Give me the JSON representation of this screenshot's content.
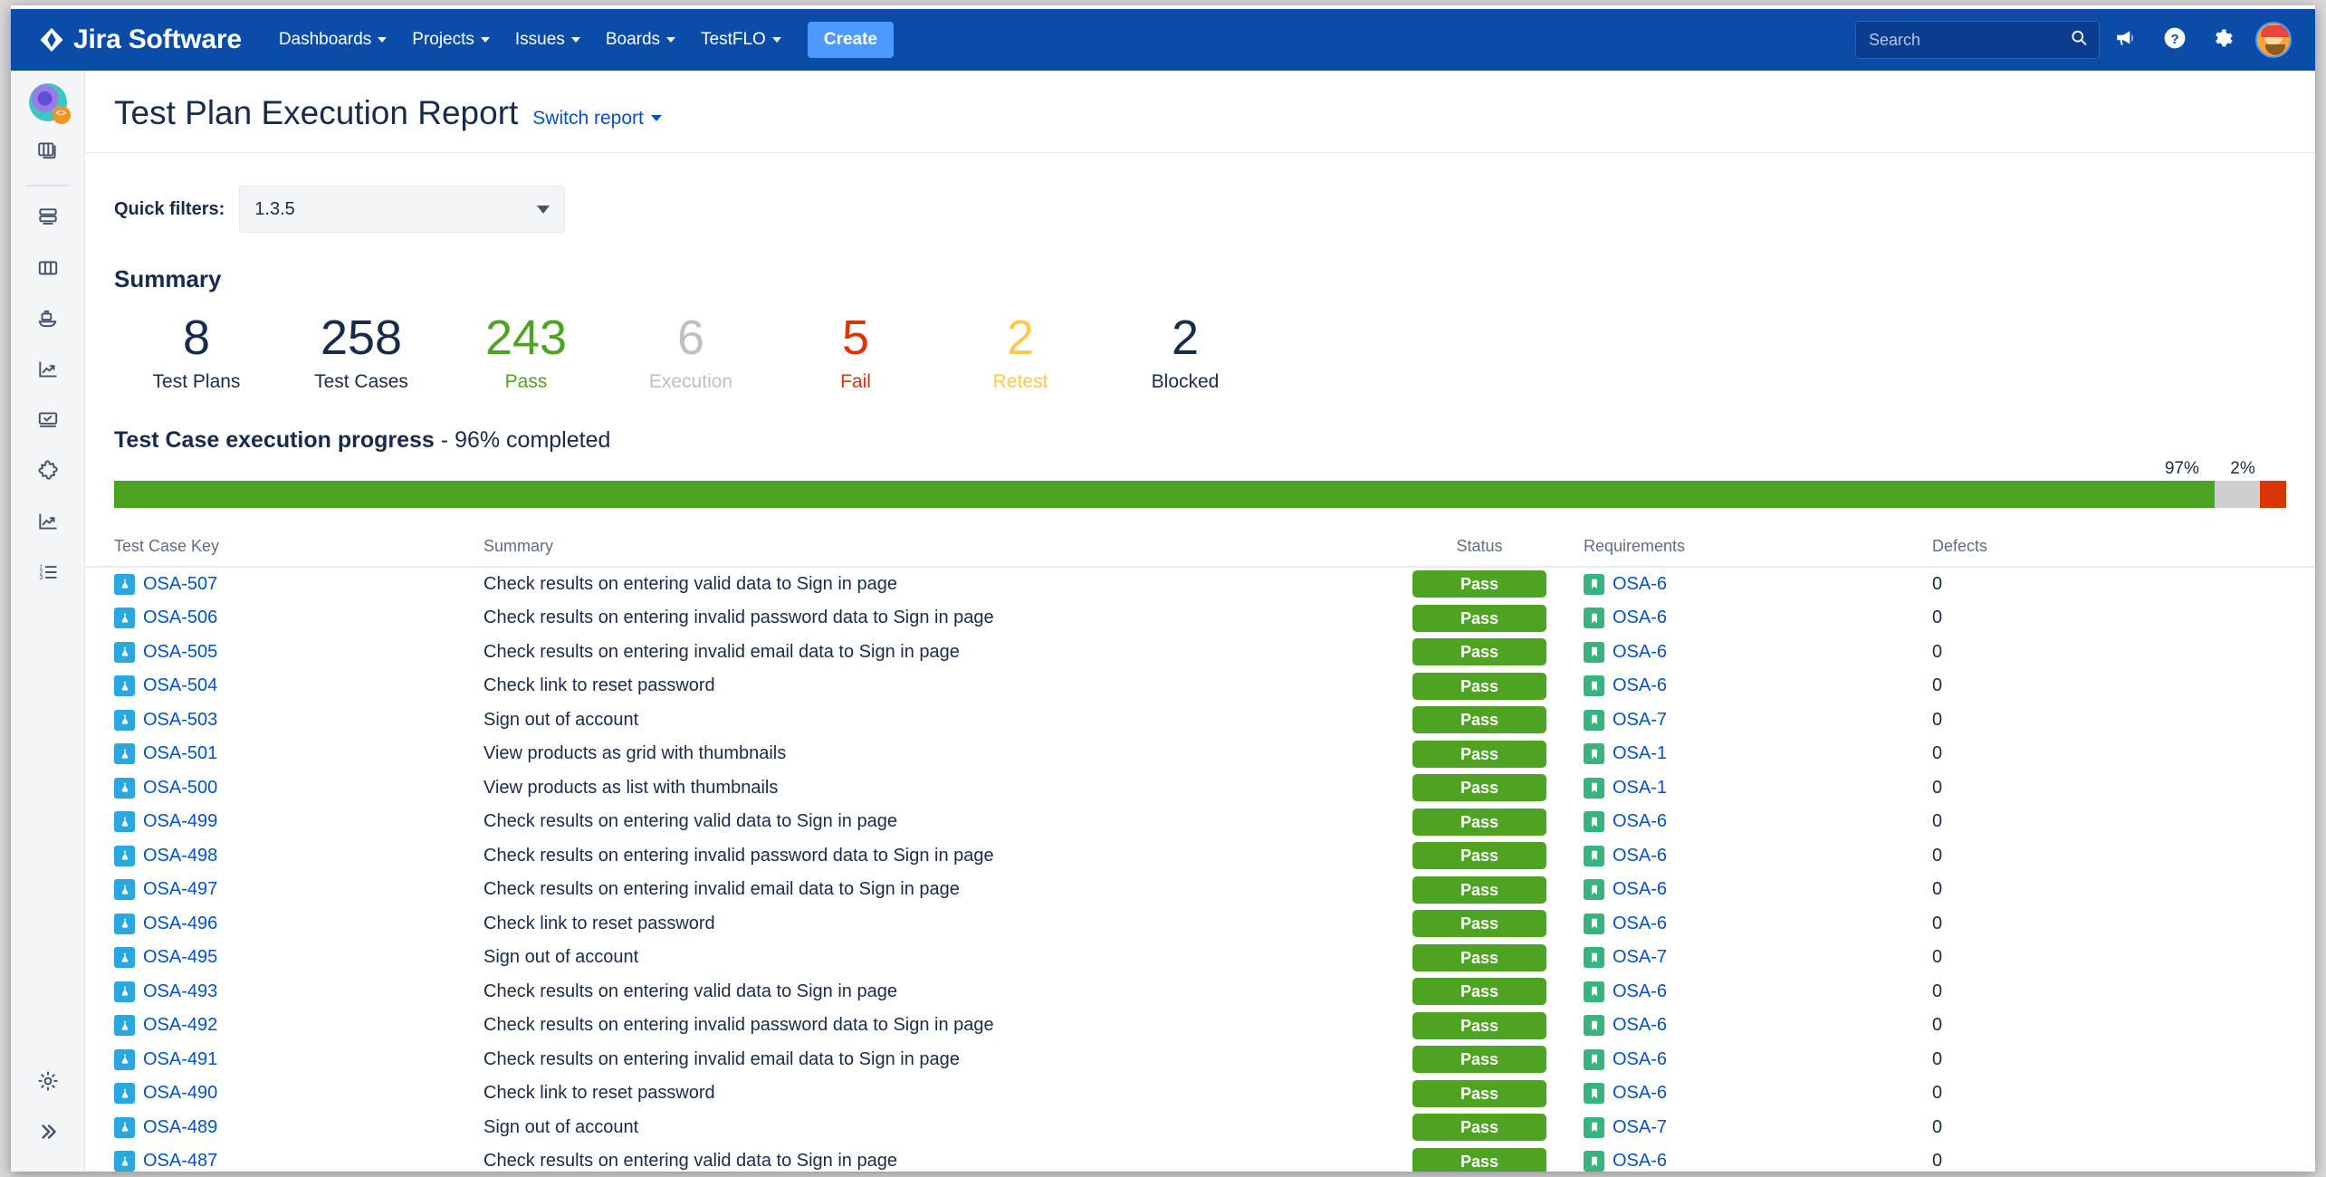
{
  "topnav": {
    "brand": "Jira Software",
    "items": [
      {
        "label": "Dashboards"
      },
      {
        "label": "Projects"
      },
      {
        "label": "Issues"
      },
      {
        "label": "Boards"
      },
      {
        "label": "TestFLO"
      }
    ],
    "create_label": "Create",
    "search_placeholder": "Search",
    "search_value": "",
    "icons": [
      "search-icon",
      "megaphone-icon",
      "help-icon",
      "settings-icon",
      "avatar"
    ]
  },
  "sidebar": {
    "items": [
      {
        "name": "project-avatar"
      },
      {
        "name": "boards-icon"
      },
      {
        "name": "backlog-icon"
      },
      {
        "name": "board-columns-icon"
      },
      {
        "name": "releases-icon"
      },
      {
        "name": "reports-icon"
      },
      {
        "name": "test-plans-icon"
      },
      {
        "name": "addons-icon"
      },
      {
        "name": "metrics-icon"
      },
      {
        "name": "issues-list-icon"
      }
    ],
    "bottom": [
      {
        "name": "settings-icon"
      },
      {
        "name": "expand-icon"
      }
    ]
  },
  "header": {
    "title": "Test Plan Execution Report",
    "switch_report": "Switch report"
  },
  "filters": {
    "label": "Quick filters:",
    "value": "1.3.5"
  },
  "summary": {
    "title": "Summary",
    "stats": [
      {
        "value": "8",
        "label": "Test Plans",
        "color": "#172B4D"
      },
      {
        "value": "258",
        "label": "Test Cases",
        "color": "#172B4D"
      },
      {
        "value": "243",
        "label": "Pass",
        "color": "#4EA322"
      },
      {
        "value": "6",
        "label": "Execution",
        "color": "#BFBFBF"
      },
      {
        "value": "5",
        "label": "Fail",
        "color": "#DC3409"
      },
      {
        "value": "2",
        "label": "Retest",
        "color": "#FFC94D"
      },
      {
        "value": "2",
        "label": "Blocked",
        "color": "#172B4D"
      }
    ]
  },
  "progress": {
    "title": "Test Case execution progress",
    "subtitle": "- 96% completed",
    "labels": [
      {
        "text": "97%",
        "left_pct": 95.2
      },
      {
        "text": "2%",
        "left_pct": 98.0
      }
    ],
    "segments": [
      {
        "name": "pass",
        "pct": 96.7,
        "color": "#4EA322"
      },
      {
        "name": "execution",
        "pct": 2.1,
        "color": "#CFCFCF"
      },
      {
        "name": "fail",
        "pct": 1.2,
        "color": "#DC3409"
      }
    ]
  },
  "table": {
    "columns": [
      "Test Case Key",
      "Summary",
      "Status",
      "Requirements",
      "Defects"
    ],
    "rows": [
      {
        "key": "OSA-507",
        "summary": "Check results on entering valid data to Sign in page",
        "status": "Pass",
        "status_color": "#4EA322",
        "requirement": "OSA-6",
        "defects": "0"
      },
      {
        "key": "OSA-506",
        "summary": "Check results on entering invalid password data to Sign in page",
        "status": "Pass",
        "status_color": "#4EA322",
        "requirement": "OSA-6",
        "defects": "0"
      },
      {
        "key": "OSA-505",
        "summary": "Check results on entering invalid email data to Sign in page",
        "status": "Pass",
        "status_color": "#4EA322",
        "requirement": "OSA-6",
        "defects": "0"
      },
      {
        "key": "OSA-504",
        "summary": "Check link to reset password",
        "status": "Pass",
        "status_color": "#4EA322",
        "requirement": "OSA-6",
        "defects": "0"
      },
      {
        "key": "OSA-503",
        "summary": "Sign out of account",
        "status": "Pass",
        "status_color": "#4EA322",
        "requirement": "OSA-7",
        "defects": "0"
      },
      {
        "key": "OSA-501",
        "summary": "View products as grid with thumbnails",
        "status": "Pass",
        "status_color": "#4EA322",
        "requirement": "OSA-1",
        "defects": "0"
      },
      {
        "key": "OSA-500",
        "summary": "View products as list with thumbnails",
        "status": "Pass",
        "status_color": "#4EA322",
        "requirement": "OSA-1",
        "defects": "0"
      },
      {
        "key": "OSA-499",
        "summary": "Check results on entering valid data to Sign in page",
        "status": "Pass",
        "status_color": "#4EA322",
        "requirement": "OSA-6",
        "defects": "0"
      },
      {
        "key": "OSA-498",
        "summary": "Check results on entering invalid password data to Sign in page",
        "status": "Pass",
        "status_color": "#4EA322",
        "requirement": "OSA-6",
        "defects": "0"
      },
      {
        "key": "OSA-497",
        "summary": "Check results on entering invalid email data to Sign in page",
        "status": "Pass",
        "status_color": "#4EA322",
        "requirement": "OSA-6",
        "defects": "0"
      },
      {
        "key": "OSA-496",
        "summary": "Check link to reset password",
        "status": "Pass",
        "status_color": "#4EA322",
        "requirement": "OSA-6",
        "defects": "0"
      },
      {
        "key": "OSA-495",
        "summary": "Sign out of account",
        "status": "Pass",
        "status_color": "#4EA322",
        "requirement": "OSA-7",
        "defects": "0"
      },
      {
        "key": "OSA-493",
        "summary": "Check results on entering valid data to Sign in page",
        "status": "Pass",
        "status_color": "#4EA322",
        "requirement": "OSA-6",
        "defects": "0"
      },
      {
        "key": "OSA-492",
        "summary": "Check results on entering invalid password data to Sign in page",
        "status": "Pass",
        "status_color": "#4EA322",
        "requirement": "OSA-6",
        "defects": "0"
      },
      {
        "key": "OSA-491",
        "summary": "Check results on entering invalid email data to Sign in page",
        "status": "Pass",
        "status_color": "#4EA322",
        "requirement": "OSA-6",
        "defects": "0"
      },
      {
        "key": "OSA-490",
        "summary": "Check link to reset password",
        "status": "Pass",
        "status_color": "#4EA322",
        "requirement": "OSA-6",
        "defects": "0"
      },
      {
        "key": "OSA-489",
        "summary": "Sign out of account",
        "status": "Pass",
        "status_color": "#4EA322",
        "requirement": "OSA-7",
        "defects": "0"
      },
      {
        "key": "OSA-487",
        "summary": "Check results on entering valid data to Sign in page",
        "status": "Pass",
        "status_color": "#4EA322",
        "requirement": "OSA-6",
        "defects": "0"
      }
    ]
  }
}
